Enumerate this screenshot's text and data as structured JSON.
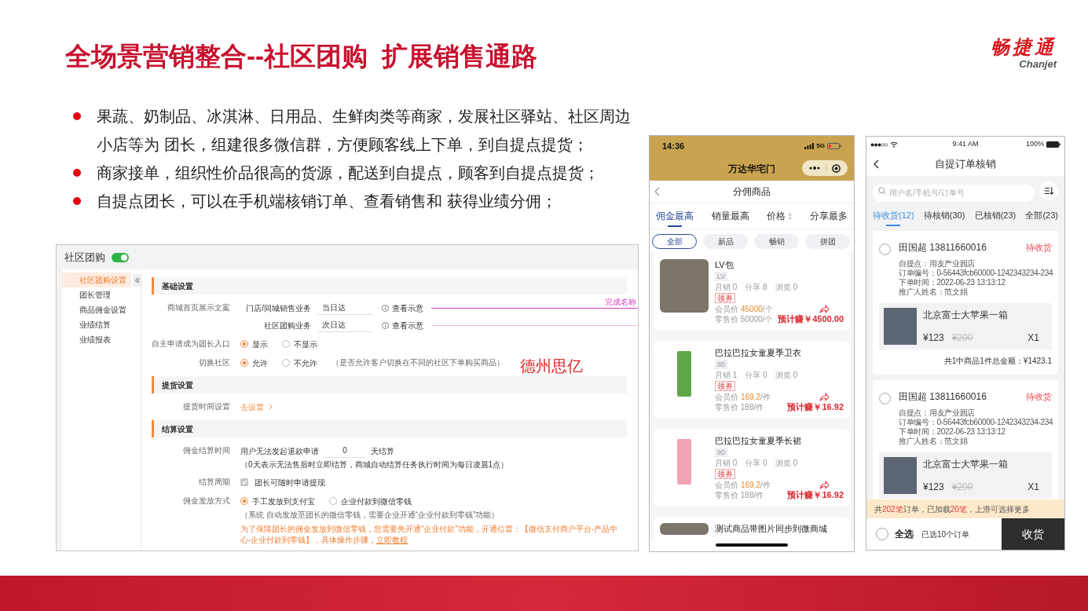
{
  "slide": {
    "title": "全场景营销整合--社区团购  扩展销售通路",
    "logo": {
      "name": "畅捷通",
      "latin": "Chanjet"
    }
  },
  "bullets": [
    "果蔬、奶制品、冰淇淋、日用品、生鲜肉类等商家，发展社区驿站、社区周边小店等为 团长，组建很多微信群，方便顾客线上下单，到自提点提货；",
    "商家接单，组织性价品很高的货源，配送到自提点，顾客到自提点提货；",
    "自提点团长，可以在手机端核销订单、查看销售和 获得业绩分佣；"
  ],
  "admin": {
    "header": {
      "title": "社区团购",
      "toggle_on": true
    },
    "sidebar": {
      "items": [
        {
          "label": "社区团购设置",
          "selected": true
        },
        {
          "label": "团长管理",
          "selected": false
        },
        {
          "label": "商品佣金设置",
          "selected": false
        },
        {
          "label": "业绩结算",
          "selected": false
        },
        {
          "label": "业绩报表",
          "selected": false
        }
      ]
    },
    "sections": [
      {
        "title": "基础设置",
        "rows": [
          {
            "kind": "inputs",
            "label": "商城首页展示文案",
            "fields": [
              {
                "label": "门店/同城销售业务",
                "value": "当日达",
                "link": "查看示意",
                "leader": true,
                "annotation": "完成名称"
              },
              {
                "label": "社区团购业务",
                "value": "次日达",
                "link": "查看示意",
                "leader": true
              }
            ]
          },
          {
            "kind": "radios",
            "label": "自主申请成为团长入口",
            "options": [
              {
                "label": "显示",
                "selected": true
              },
              {
                "label": "不显示",
                "selected": false
              }
            ]
          },
          {
            "kind": "radios",
            "label": "切换社区",
            "options": [
              {
                "label": "允许",
                "selected": true
              },
              {
                "label": "不允许",
                "selected": false
              }
            ],
            "note": "（是否允许客户切换在不同的社区下单购买商品）"
          }
        ]
      },
      {
        "title": "提货设置",
        "rows": [
          {
            "kind": "link",
            "label": "提货时间设置",
            "link": "去设置"
          }
        ]
      },
      {
        "title": "结算设置",
        "rows": [
          {
            "kind": "input_inline",
            "label": "佣金结算时间",
            "before": "用户无法发起退款申请",
            "value": "0",
            "after": "天结算",
            "note": "（0天表示无法售后时立即结算，商城自动结算任务执行时间为每日凌晨1点）"
          },
          {
            "kind": "checkbox",
            "label": "结算周期",
            "option": {
              "label": "团长可随时申请提现",
              "checked": true,
              "disabled": true
            }
          },
          {
            "kind": "radios",
            "label": "佣金发放方式",
            "options": [
              {
                "label": "手工发放到支付宝",
                "selected": true
              },
              {
                "label": "企业付款到微信零钱",
                "selected": false
              }
            ],
            "note": "（系统 自动发放至团长的微信零钱，需要企业开通“企业付款到零钱”功能）",
            "warning": "为了保障团长的佣金发放到微信零钱，您需要先开通“企业付款”功能，开通位置：【微信支付商户平台-产品中心-企业付款到零钱】，具体操作步骤，",
            "warning_link": "立即教程"
          }
        ]
      }
    ],
    "overlay_label": "德州思亿"
  },
  "product_phone": {
    "status_bar": {
      "time": "14:36",
      "network": "5G"
    },
    "app_title": "万达华宅门",
    "page_title": "分佣商品",
    "tabs": [
      {
        "label": "佣金最高",
        "selected": true,
        "sortable": false
      },
      {
        "label": "销量最高",
        "selected": false,
        "sortable": false
      },
      {
        "label": "价格",
        "selected": false,
        "sortable": true
      },
      {
        "label": "分享最多",
        "selected": false,
        "sortable": false
      }
    ],
    "filters": [
      {
        "label": "全部",
        "selected": true
      },
      {
        "label": "新品",
        "selected": false
      },
      {
        "label": "畅销",
        "selected": false
      },
      {
        "label": "拼团",
        "selected": false
      }
    ],
    "products": [
      {
        "kind": "photo",
        "name": "LV包",
        "tag": "LV",
        "stats": [
          "月销 0",
          "分享 8",
          "浏览 0"
        ],
        "coupon": "领券",
        "member_price": {
          "label": "会员价",
          "value": "45000",
          "unit": "/个"
        },
        "retail_price": "零售价 50000/个",
        "earnings": "预计赚￥4500.00"
      },
      {
        "kind": "package",
        "color": "#5fa84a",
        "name": "巴拉巴拉女童夏季卫衣",
        "tag": "80",
        "stats": [
          "月销 1",
          "分享 0",
          "浏览 0"
        ],
        "coupon": "领券",
        "member_price": {
          "label": "会员价",
          "value": "169.2",
          "unit": "/件"
        },
        "retail_price": "零售价 188/件",
        "earnings": "预计赚￥16.92"
      },
      {
        "kind": "package",
        "color": "#f0a3b5",
        "name": "巴拉巴拉女童夏季长裙",
        "tag": "90",
        "stats": [
          "月销 0",
          "分享 0",
          "浏览 0"
        ],
        "coupon": "领券",
        "member_price": {
          "label": "会员价",
          "value": "169.2",
          "unit": "/件"
        },
        "retail_price": "零售价 188/件",
        "earnings": "预计赚￥16.92"
      },
      {
        "kind": "photo",
        "name": "测试商品带图片同步到微商城"
      }
    ]
  },
  "order_phone": {
    "status_bar": {
      "time": "9:41 AM",
      "battery": "100%"
    },
    "page_title": "自提订单核销",
    "search": {
      "placeholder": "用户名/手机号/订单号"
    },
    "tabs": [
      {
        "label": "待收货(12)",
        "selected": true
      },
      {
        "label": "待核销(30)",
        "selected": false
      },
      {
        "label": "已核销(23)",
        "selected": false
      },
      {
        "label": "全部(23)",
        "selected": false
      }
    ],
    "orders": [
      {
        "selected": false,
        "customer": "田国超 13811660016",
        "status": "待收货",
        "details": [
          "自提点：用友产业园店",
          "订单编号：0-56443fcb60000-1242343234-234",
          "下单时间：2022-06-23 13:13:12",
          "推广人姓名：范文娟"
        ],
        "item": {
          "name": "北京富士大苹果一箱",
          "price": "¥123",
          "original_price": "¥200",
          "quantity": "X1"
        },
        "total": "共1中商品1件总金额：¥1423.1"
      },
      {
        "selected": false,
        "customer": "田国超 13811660016",
        "status": "待收货",
        "details": [
          "自提点：用友产业园店",
          "订单编号：0-56443fcb60000-1242343234-234",
          "下单时间：2022-06-23 13:13:12",
          "推广人姓名：范文娟"
        ],
        "item": {
          "name": "北京富士大苹果一箱",
          "price": "¥123",
          "original_price": "¥200",
          "quantity": "X1"
        }
      }
    ],
    "notice": [
      {
        "text": "共",
        "highlight": false
      },
      {
        "text": "202笔",
        "highlight": true
      },
      {
        "text": "订单，已加载",
        "highlight": false
      },
      {
        "text": "20笔",
        "highlight": true
      },
      {
        "text": "，上滑可选择更多",
        "highlight": false
      }
    ],
    "footer": {
      "select_all": "全选",
      "select_all_checked": false,
      "selected_count": "已选10个订单",
      "action": "收货"
    }
  }
}
